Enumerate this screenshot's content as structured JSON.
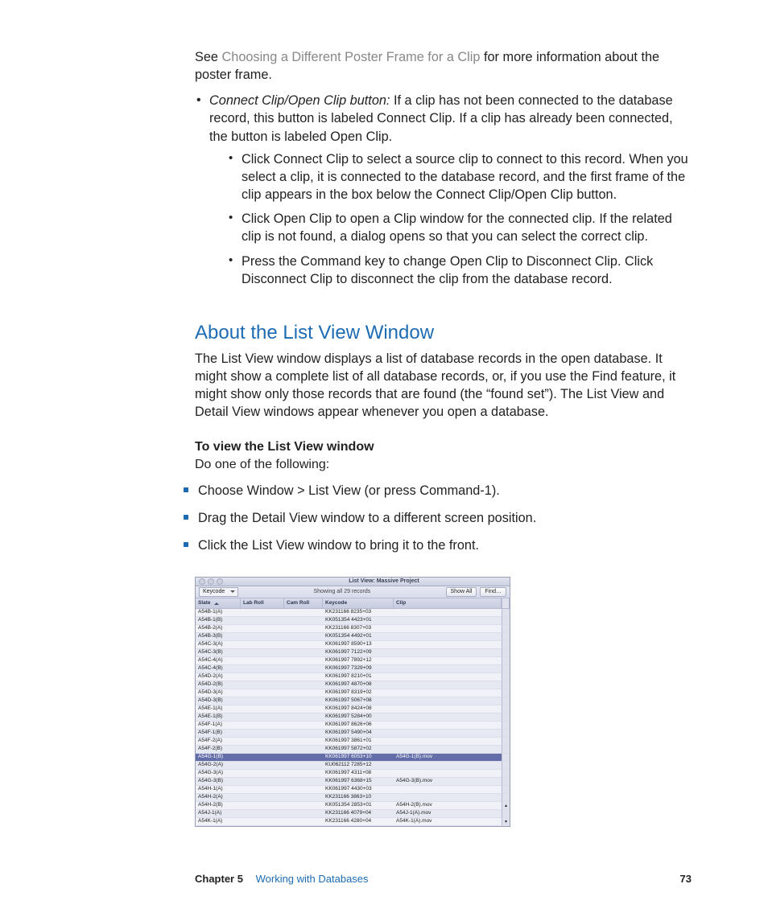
{
  "intro": {
    "see_prefix": "See ",
    "see_link": "Choosing a Different Poster Frame for a Clip",
    "see_suffix": " for more information about the poster frame."
  },
  "connect_clip": {
    "label": "Connect Clip/Open Clip button:",
    "intro": "  If a clip has not been connected to the database record, this button is labeled Connect Clip. If a clip has already been connected, the button is labeled Open Clip.",
    "sub1": "Click Connect Clip to select a source clip to connect to this record. When you select a clip, it is connected to the database record, and the first frame of the clip appears in the box below the Connect Clip/Open Clip button.",
    "sub2": "Click Open Clip to open a Clip window for the connected clip. If the related clip is not found, a dialog opens so that you can select the correct clip.",
    "sub3": "Press the Command key to change Open Clip to Disconnect Clip. Click Disconnect Clip to disconnect the clip from the database record."
  },
  "about_section": {
    "heading": "About the List View Window",
    "para": "The List View window displays a list of database records in the open database. It might show a complete list of all database records, or, if you use the Find feature, it might show only those records that are found (the “found set”). The List View and Detail View windows appear whenever you open a database.",
    "step_title": "To view the List View window",
    "step_lead": "Do one of the following:",
    "steps": [
      "Choose Window > List View (or press Command-1).",
      "Drag the Detail View window to a different screen position.",
      "Click the List View window to bring it to the front."
    ]
  },
  "listview": {
    "title": "List View: Massive Project",
    "toolbar": {
      "select_label": "Keycode",
      "status": "Showing all 29 records",
      "show_all": "Show All",
      "find": "Find…"
    },
    "columns": [
      "Slate",
      "Lab Roll",
      "Cam Roll",
      "Keycode",
      "Clip"
    ],
    "selected_index": 18,
    "rows": [
      {
        "slate": "A54B-1(A)",
        "lab": "",
        "cam": "",
        "key": "KK231166 8235+03",
        "clip": ""
      },
      {
        "slate": "A54B-1(B)",
        "lab": "",
        "cam": "",
        "key": "KK051354 4423+01",
        "clip": ""
      },
      {
        "slate": "A54B-2(A)",
        "lab": "",
        "cam": "",
        "key": "KK231166 8307+03",
        "clip": ""
      },
      {
        "slate": "A54B-3(B)",
        "lab": "",
        "cam": "",
        "key": "KK051354 4492+01",
        "clip": ""
      },
      {
        "slate": "A54C-3(A)",
        "lab": "",
        "cam": "",
        "key": "KK061997 8590+13",
        "clip": ""
      },
      {
        "slate": "A54C-3(B)",
        "lab": "",
        "cam": "",
        "key": "KK061997 7122+09",
        "clip": ""
      },
      {
        "slate": "A54C-4(A)",
        "lab": "",
        "cam": "",
        "key": "KK061997 7892+12",
        "clip": ""
      },
      {
        "slate": "A54C-4(B)",
        "lab": "",
        "cam": "",
        "key": "KK061997 7329+09",
        "clip": ""
      },
      {
        "slate": "A54D-2(A)",
        "lab": "",
        "cam": "",
        "key": "KK061997 8210+01",
        "clip": ""
      },
      {
        "slate": "A54D-2(B)",
        "lab": "",
        "cam": "",
        "key": "KK061997 4870+08",
        "clip": ""
      },
      {
        "slate": "A54D-3(A)",
        "lab": "",
        "cam": "",
        "key": "KK061997 8319+02",
        "clip": ""
      },
      {
        "slate": "A54D-3(B)",
        "lab": "",
        "cam": "",
        "key": "KK061997 5067+08",
        "clip": ""
      },
      {
        "slate": "A54E-1(A)",
        "lab": "",
        "cam": "",
        "key": "KK061997 8424+08",
        "clip": ""
      },
      {
        "slate": "A54E-1(B)",
        "lab": "",
        "cam": "",
        "key": "KK061997 5284+00",
        "clip": ""
      },
      {
        "slate": "A54F-1(A)",
        "lab": "",
        "cam": "",
        "key": "KK061997 8626+06",
        "clip": ""
      },
      {
        "slate": "A54F-1(B)",
        "lab": "",
        "cam": "",
        "key": "KK061997 5490+04",
        "clip": ""
      },
      {
        "slate": "A54F-2(A)",
        "lab": "",
        "cam": "",
        "key": "KK061997 3861+01",
        "clip": ""
      },
      {
        "slate": "A54F-2(B)",
        "lab": "",
        "cam": "",
        "key": "KK061997 5872+02",
        "clip": ""
      },
      {
        "slate": "A54G-1(B)",
        "lab": "",
        "cam": "",
        "key": "KK061997 6053+10",
        "clip": "A54G-1(B).mov"
      },
      {
        "slate": "A54G-2(A)",
        "lab": "",
        "cam": "",
        "key": "KU062112 7285+12",
        "clip": ""
      },
      {
        "slate": "A54G-3(A)",
        "lab": "",
        "cam": "",
        "key": "KK061997 4311+08",
        "clip": ""
      },
      {
        "slate": "A54G-3(B)",
        "lab": "",
        "cam": "",
        "key": "KK061997 6368+15",
        "clip": "A54G-3(B).mov"
      },
      {
        "slate": "A54H-1(A)",
        "lab": "",
        "cam": "",
        "key": "KK061997 4430+03",
        "clip": ""
      },
      {
        "slate": "A54H-2(A)",
        "lab": "",
        "cam": "",
        "key": "KK231166 3863+10",
        "clip": ""
      },
      {
        "slate": "A54H-2(B)",
        "lab": "",
        "cam": "",
        "key": "KK051354 2853+01",
        "clip": "A54H-2(B).mov"
      },
      {
        "slate": "A54J-1(A)",
        "lab": "",
        "cam": "",
        "key": "KK231166 4079+04",
        "clip": "A54J-1(A).mov"
      },
      {
        "slate": "A54K-1(A)",
        "lab": "",
        "cam": "",
        "key": "KK231166 4280+04",
        "clip": "A54K-1(A).mov"
      }
    ]
  },
  "footer": {
    "chapter_label": "Chapter 5",
    "chapter_title": "Working with Databases",
    "page_number": "73"
  }
}
